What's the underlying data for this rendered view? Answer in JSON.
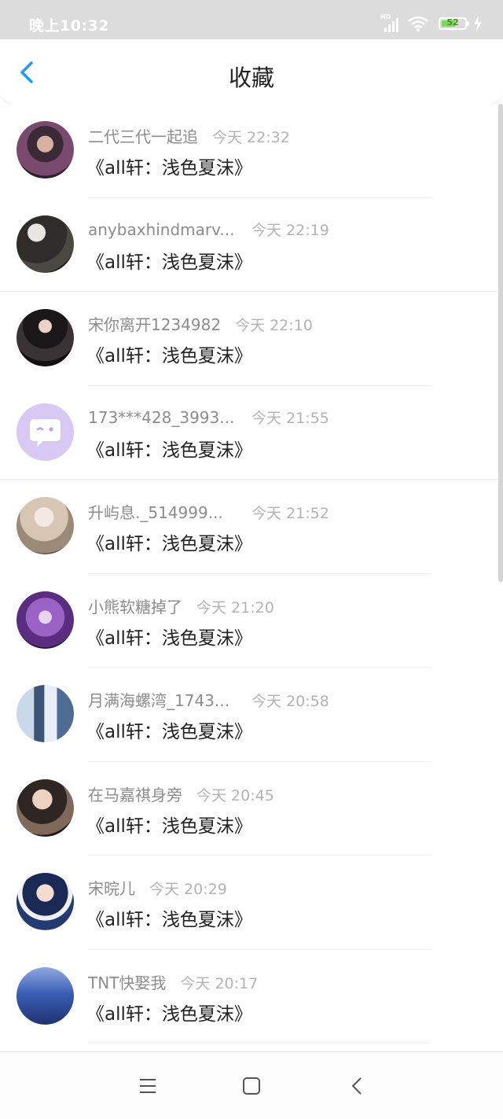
{
  "status": {
    "time": "晚上10:32",
    "battery_level": "52"
  },
  "header": {
    "title": "收藏"
  },
  "items": [
    {
      "name": "二代三代一起追",
      "time": "今天 22:32",
      "content": "《all轩：浅色夏沫》"
    },
    {
      "name": "anybaxhindmarv...",
      "time": "今天 22:19",
      "content": "《all轩：浅色夏沫》"
    },
    {
      "name": "宋你离开1234982",
      "time": "今天 22:10",
      "content": "《all轩：浅色夏沫》"
    },
    {
      "name": "173***428_3993...",
      "time": "今天 21:55",
      "content": "《all轩：浅色夏沫》"
    },
    {
      "name": "升屿息._514999...",
      "time": "今天 21:52",
      "content": "《all轩：浅色夏沫》"
    },
    {
      "name": "小熊软糖掉了",
      "time": "今天 21:20",
      "content": "《all轩：浅色夏沫》"
    },
    {
      "name": "月满海螺湾_1743...",
      "time": "今天 20:58",
      "content": "《all轩：浅色夏沫》"
    },
    {
      "name": "在马嘉祺身旁",
      "time": "今天 20:45",
      "content": "《all轩：浅色夏沫》"
    },
    {
      "name": "宋晥儿",
      "time": "今天 20:29",
      "content": "《all轩：浅色夏沫》"
    },
    {
      "name": "TNT快娶我",
      "time": "今天 20:17",
      "content": "《all轩：浅色夏沫》"
    }
  ]
}
